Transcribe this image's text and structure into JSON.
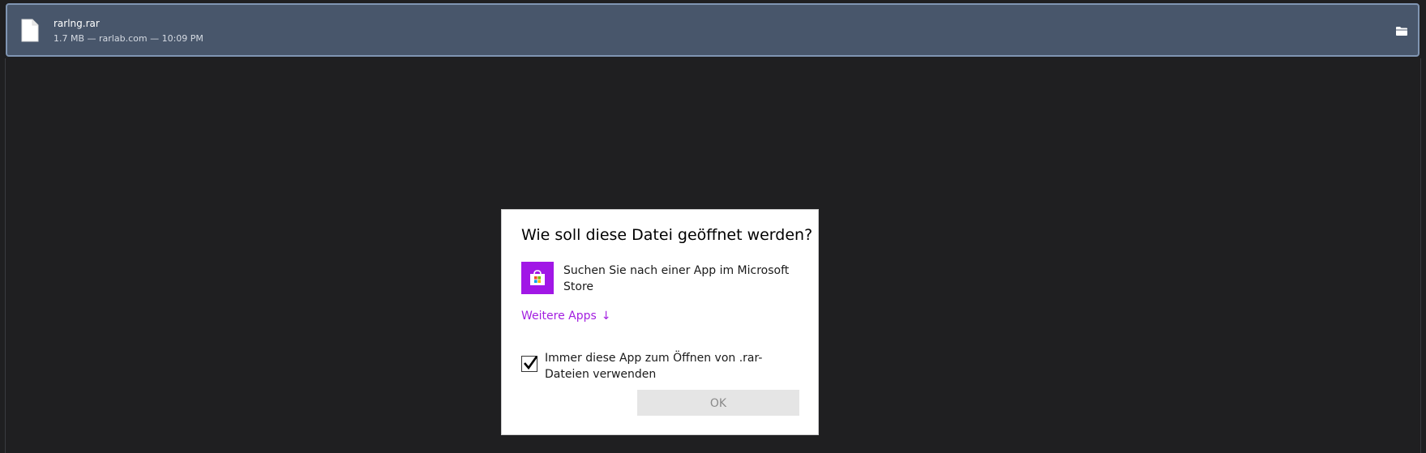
{
  "download": {
    "file_name": "rarlng.rar",
    "meta": "1.7 MB — rarlab.com — 10:09 PM",
    "file_icon": "file-icon",
    "folder_icon": "folder-icon"
  },
  "dialog": {
    "title": "Wie soll diese Datei geöffnet werden?",
    "store_option_label": "Suchen Sie nach einer App im Microsoft Store",
    "store_icon": "microsoft-store-icon",
    "more_apps_label": "Weitere Apps",
    "more_apps_arrow": "↓",
    "always_use_label": "Immer diese App zum Öffnen von .rar-Dateien verwenden",
    "always_use_checked": true,
    "ok_label": "OK"
  },
  "colors": {
    "download_bg": "#48566b",
    "download_border": "#8095b3",
    "store_purple": "#a117e6",
    "link_purple": "#a31fe0",
    "page_bg": "#1f1f21"
  }
}
